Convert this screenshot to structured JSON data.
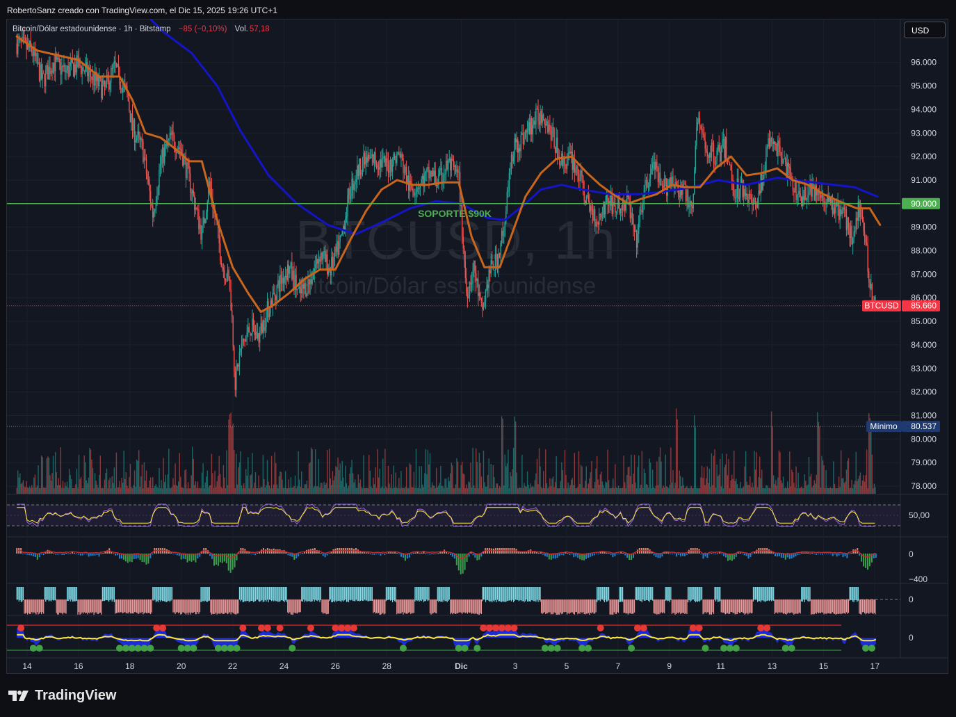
{
  "header": {
    "credit": "RobertoSanz creado con TradingView.com, el Dic 15, 2025 19:26 UTC+1"
  },
  "legend": {
    "symbol": "Bitcoin/Dólar estadounidense · 1h · Bitstamp",
    "change": "−85 (−0,10%)",
    "vol_label": "Vol.",
    "vol_value": "57,18"
  },
  "currency_button": "USD",
  "watermark": {
    "ticker": "BTCUSD, 1h",
    "name": "Bitcoin/Dólar estadounidense"
  },
  "brand": "TradingView",
  "colors": {
    "up": "#26a69a",
    "down": "#ef5350",
    "ema_fast": "#c8661e",
    "ema_slow": "#1414c8",
    "support": "#4caf50",
    "last_price": "#f23645",
    "minimum": "#1e3a6e"
  },
  "chart_data": {
    "type": "candlestick",
    "symbol": "BTCUSD",
    "interval": "1h",
    "exchange": "Bitstamp",
    "ylim": [
      77500,
      97500
    ],
    "y_ticks": [
      "78.000",
      "79.000",
      "80.000",
      "81.000",
      "82.000",
      "83.000",
      "84.000",
      "85.000",
      "86.000",
      "87.000",
      "88.000",
      "89.000",
      "90.000",
      "91.000",
      "92.000",
      "93.000",
      "94.000",
      "95.000",
      "96.000"
    ],
    "x_ticks": [
      "14",
      "16",
      "18",
      "20",
      "22",
      "24",
      "26",
      "28",
      "Dic",
      "3",
      "5",
      "7",
      "9",
      "11",
      "13",
      "15",
      "17"
    ],
    "close_path": [
      [
        13.6,
        96800
      ],
      [
        14.2,
        96500
      ],
      [
        14.6,
        95200
      ],
      [
        15,
        96000
      ],
      [
        15.5,
        95600
      ],
      [
        16,
        95900
      ],
      [
        16.5,
        95400
      ],
      [
        17,
        94800
      ],
      [
        17.4,
        95800
      ],
      [
        17.9,
        94600
      ],
      [
        18.1,
        93200
      ],
      [
        18.5,
        92300
      ],
      [
        18.9,
        89500
      ],
      [
        19.2,
        91800
      ],
      [
        19.6,
        92800
      ],
      [
        20,
        92300
      ],
      [
        20.4,
        90600
      ],
      [
        20.8,
        88700
      ],
      [
        21.1,
        90900
      ],
      [
        21.6,
        87400
      ],
      [
        21.9,
        86600
      ],
      [
        22.1,
        82400
      ],
      [
        22.3,
        83800
      ],
      [
        22.7,
        84800
      ],
      [
        23,
        84300
      ],
      [
        23.4,
        85600
      ],
      [
        23.8,
        86600
      ],
      [
        24.2,
        87300
      ],
      [
        24.6,
        86100
      ],
      [
        25,
        86700
      ],
      [
        25.4,
        87900
      ],
      [
        25.8,
        87200
      ],
      [
        26.2,
        88400
      ],
      [
        26.6,
        90700
      ],
      [
        27,
        91700
      ],
      [
        27.5,
        91900
      ],
      [
        28,
        91600
      ],
      [
        28.5,
        92100
      ],
      [
        28.9,
        90600
      ],
      [
        29.3,
        90900
      ],
      [
        29.7,
        91300
      ],
      [
        30,
        90900
      ],
      [
        30.4,
        91700
      ],
      [
        30.8,
        91100
      ],
      [
        31.1,
        86200
      ],
      [
        31.4,
        87300
      ],
      [
        31.7,
        85300
      ],
      [
        32,
        87100
      ],
      [
        32.3,
        87600
      ],
      [
        32.6,
        89300
      ],
      [
        32.9,
        92300
      ],
      [
        33.3,
        92800
      ],
      [
        33.8,
        93600
      ],
      [
        34.1,
        93900
      ],
      [
        34.4,
        93000
      ],
      [
        34.8,
        91800
      ],
      [
        35.2,
        91900
      ],
      [
        35.5,
        91200
      ],
      [
        35.8,
        90000
      ],
      [
        36.2,
        89300
      ],
      [
        36.6,
        90200
      ],
      [
        37,
        89700
      ],
      [
        37.4,
        90100
      ],
      [
        37.7,
        88300
      ],
      [
        38,
        90400
      ],
      [
        38.4,
        91700
      ],
      [
        38.7,
        90500
      ],
      [
        39.1,
        91100
      ],
      [
        39.5,
        90500
      ],
      [
        39.9,
        90000
      ],
      [
        40.1,
        93600
      ],
      [
        40.4,
        92300
      ],
      [
        40.8,
        92100
      ],
      [
        41.2,
        92400
      ],
      [
        41.5,
        90600
      ],
      [
        41.9,
        90700
      ],
      [
        42.3,
        89800
      ],
      [
        42.6,
        91000
      ],
      [
        42.9,
        92700
      ],
      [
        43.3,
        92300
      ],
      [
        43.6,
        91400
      ],
      [
        44,
        90200
      ],
      [
        44.4,
        90600
      ],
      [
        44.8,
        90400
      ],
      [
        45.2,
        90100
      ],
      [
        45.6,
        89700
      ],
      [
        45.9,
        89300
      ],
      [
        46.1,
        88500
      ],
      [
        46.3,
        89700
      ],
      [
        46.5,
        89900
      ],
      [
        46.6,
        88800
      ],
      [
        46.8,
        86500
      ],
      [
        47.05,
        85660
      ]
    ],
    "ema_fast": [
      [
        13.6,
        97100
      ],
      [
        14.4,
        96500
      ],
      [
        15.2,
        96300
      ],
      [
        16,
        96100
      ],
      [
        16.8,
        95400
      ],
      [
        17.6,
        95400
      ],
      [
        18.1,
        94400
      ],
      [
        18.6,
        93000
      ],
      [
        19.2,
        92800
      ],
      [
        19.8,
        92300
      ],
      [
        20.3,
        91800
      ],
      [
        20.8,
        91800
      ],
      [
        21.4,
        89300
      ],
      [
        22,
        87300
      ],
      [
        22.6,
        86200
      ],
      [
        23.1,
        85400
      ],
      [
        23.6,
        85700
      ],
      [
        24.2,
        86200
      ],
      [
        24.8,
        86800
      ],
      [
        25.4,
        87200
      ],
      [
        26,
        87200
      ],
      [
        26.6,
        88500
      ],
      [
        27.2,
        89700
      ],
      [
        27.8,
        90600
      ],
      [
        28.4,
        91000
      ],
      [
        29,
        90800
      ],
      [
        29.6,
        90800
      ],
      [
        30.2,
        90900
      ],
      [
        30.8,
        90900
      ],
      [
        31.3,
        88600
      ],
      [
        31.8,
        87300
      ],
      [
        32.4,
        87300
      ],
      [
        32.9,
        88800
      ],
      [
        33.4,
        90300
      ],
      [
        34,
        91300
      ],
      [
        34.6,
        91900
      ],
      [
        35.2,
        92000
      ],
      [
        35.8,
        91300
      ],
      [
        36.3,
        90800
      ],
      [
        36.8,
        90400
      ],
      [
        37.4,
        90000
      ],
      [
        37.9,
        90200
      ],
      [
        38.5,
        90400
      ],
      [
        39.1,
        90800
      ],
      [
        39.6,
        90700
      ],
      [
        40.2,
        90700
      ],
      [
        40.8,
        91500
      ],
      [
        41.4,
        92000
      ],
      [
        42,
        91200
      ],
      [
        42.6,
        91300
      ],
      [
        43.2,
        91500
      ],
      [
        43.8,
        91000
      ],
      [
        44.4,
        90800
      ],
      [
        45,
        90400
      ],
      [
        45.6,
        90100
      ],
      [
        46.3,
        89800
      ],
      [
        46.8,
        89800
      ],
      [
        47.2,
        89100
      ]
    ],
    "ema_slow": [
      [
        13.6,
        99400
      ],
      [
        18,
        98700
      ],
      [
        19.3,
        97300
      ],
      [
        20.4,
        96400
      ],
      [
        21.4,
        95000
      ],
      [
        22.3,
        93100
      ],
      [
        23.4,
        91200
      ],
      [
        24.5,
        90000
      ],
      [
        25.7,
        89100
      ],
      [
        26.8,
        88700
      ],
      [
        27.8,
        89200
      ],
      [
        28.9,
        89800
      ],
      [
        29.9,
        90100
      ],
      [
        30.9,
        90000
      ],
      [
        31.9,
        89400
      ],
      [
        32.6,
        89300
      ],
      [
        33.4,
        90000
      ],
      [
        34,
        90600
      ],
      [
        34.8,
        90800
      ],
      [
        35.6,
        90600
      ],
      [
        36.7,
        90400
      ],
      [
        37.8,
        90400
      ],
      [
        38.7,
        90500
      ],
      [
        39.9,
        90700
      ],
      [
        40.9,
        91000
      ],
      [
        42,
        90800
      ],
      [
        43.2,
        91100
      ],
      [
        44.6,
        90900
      ],
      [
        46.2,
        90700
      ],
      [
        47.1,
        90300
      ]
    ],
    "support_level": 90000,
    "support_label": "SOPORTE $90K",
    "last_price": 85660,
    "last_price_label": "BTCUSD",
    "last_price_value": "85.660",
    "minimum": 80537,
    "minimum_label": "Mínimo",
    "minimum_value": "80.537",
    "support_value": "90.000",
    "series": [
      {
        "name": "BTCUSD",
        "kind": "candles"
      },
      {
        "name": "",
        "kind": "ema_fast"
      },
      {
        "name": "",
        "kind": "ema_slow"
      },
      {
        "name": "Vol.",
        "kind": "volume"
      }
    ],
    "volume_marker_days": [
      21.9,
      22.0,
      32.5,
      33.0,
      39.3,
      40.0,
      43.0,
      44.8,
      46.8
    ],
    "panes": [
      {
        "name": "rsi",
        "axis_tick": "50,00",
        "bands": [
          70,
          30
        ]
      },
      {
        "name": "oscillator_2",
        "axis_ticks": [
          "0",
          "−400"
        ]
      },
      {
        "name": "oscillator_3",
        "axis_tick": "0"
      },
      {
        "name": "oscillator_4",
        "axis_tick": "0"
      }
    ]
  }
}
